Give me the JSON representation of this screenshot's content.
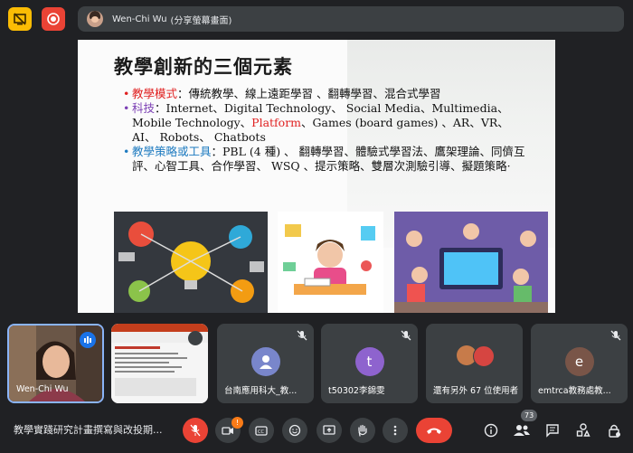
{
  "presenter": {
    "name": "Wen-Chi Wu",
    "status": "(分享螢幕畫面)"
  },
  "slide": {
    "title": "教學創新的三個元素",
    "bullets": [
      {
        "dot": "•",
        "key": "教學模式",
        "text": "：傳統教學、線上遠距學習 、翻轉學習、混合式學習"
      },
      {
        "dot": "•",
        "key": "科技",
        "text_before": "：Internet、Digital Technology、 Social Media、Multimedia、Mobile Technology、",
        "highlight": "Platform",
        "text_after": "、Games (board games) 、AR、VR、AI、 Robots、 Chatbots"
      },
      {
        "dot": "•",
        "key": "教學策略或工具",
        "text": "：PBL (4 種) 、 翻轉學習、體驗式學習法、鷹架理論、同儕互評、心智工具、合作學習、 WSQ 、提示策略、雙層次測驗引導、擬題策略·"
      }
    ]
  },
  "participants": [
    {
      "name": "Wen-Chi Wu",
      "initial": "",
      "color": "#1a73e8"
    },
    {
      "name": "",
      "initial": "",
      "color": ""
    },
    {
      "name": "台南應用科大_教...",
      "initial": "",
      "color": "#7986cb"
    },
    {
      "name": "t50302李錦雯",
      "initial": "t",
      "color": "#8e63ce"
    },
    {
      "name": "還有另外 67 位使用者",
      "initial": "",
      "color": ""
    },
    {
      "name": "emtrca教務處教...",
      "initial": "e",
      "color": "#795548"
    }
  ],
  "meeting": {
    "title": "教學實踐研究計畫撰寫與改投期...",
    "people_count": "73",
    "activity_badge": "!"
  },
  "icons": [
    "stop-present-icon",
    "record-icon",
    "mic-off-icon",
    "camera-icon",
    "captions-icon",
    "emoji-icon",
    "present-icon",
    "raise-hand-icon",
    "more-icon",
    "hangup-icon",
    "info-icon",
    "people-icon",
    "chat-icon",
    "activities-icon",
    "lock-icon"
  ]
}
